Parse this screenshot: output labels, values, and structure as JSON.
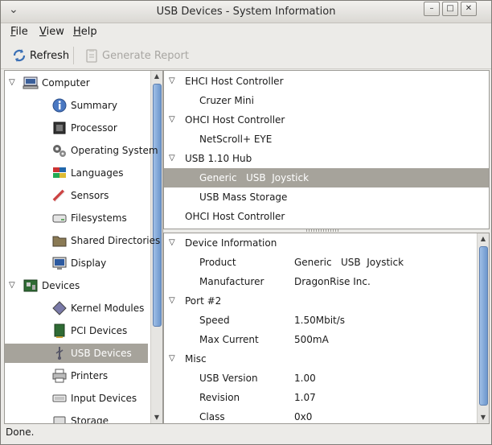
{
  "window": {
    "title": "USB Devices - System Information"
  },
  "menu": {
    "file": "File",
    "view": "View",
    "help": "Help"
  },
  "toolbar": {
    "refresh": "Refresh",
    "report": "Generate Report"
  },
  "sidebar": {
    "items": [
      {
        "label": "Computer",
        "icon": "computer-icon",
        "level": 0,
        "expanded": true
      },
      {
        "label": "Summary",
        "icon": "info-icon",
        "level": 1
      },
      {
        "label": "Processor",
        "icon": "processor-icon",
        "level": 1
      },
      {
        "label": "Operating System",
        "icon": "gears-icon",
        "level": 1
      },
      {
        "label": "Languages",
        "icon": "flags-icon",
        "level": 1
      },
      {
        "label": "Sensors",
        "icon": "sensors-icon",
        "level": 1
      },
      {
        "label": "Filesystems",
        "icon": "drive-icon",
        "level": 1
      },
      {
        "label": "Shared Directories",
        "icon": "folder-icon",
        "level": 1
      },
      {
        "label": "Display",
        "icon": "monitor-icon",
        "level": 1
      },
      {
        "label": "Devices",
        "icon": "board-icon",
        "level": 0,
        "expanded": true
      },
      {
        "label": "Kernel Modules",
        "icon": "module-icon",
        "level": 1
      },
      {
        "label": "PCI Devices",
        "icon": "pci-icon",
        "level": 1
      },
      {
        "label": "USB Devices",
        "icon": "usb-icon",
        "level": 1,
        "selected": true
      },
      {
        "label": "Printers",
        "icon": "printer-icon",
        "level": 1
      },
      {
        "label": "Input Devices",
        "icon": "keyboard-icon",
        "level": 1
      },
      {
        "label": "Storage",
        "icon": "storage-icon",
        "level": 1
      }
    ]
  },
  "devices": {
    "items": [
      {
        "label": "EHCI Host Controller",
        "level": 0,
        "expander": true
      },
      {
        "label": "Cruzer Mini",
        "level": 1
      },
      {
        "label": "OHCI Host Controller",
        "level": 0,
        "expander": true
      },
      {
        "label": "NetScroll+ EYE",
        "level": 1
      },
      {
        "label": "USB 1.10 Hub",
        "level": 0,
        "expander": true
      },
      {
        "label": "Generic   USB  Joystick",
        "level": 1,
        "selected": true
      },
      {
        "label": "USB Mass Storage",
        "level": 1
      },
      {
        "label": "OHCI Host Controller",
        "level": 0,
        "expander": false
      }
    ]
  },
  "details": {
    "rows": [
      {
        "label": "Device Information",
        "section": true
      },
      {
        "label": "Product",
        "value": "Generic   USB  Joystick"
      },
      {
        "label": "Manufacturer",
        "value": "DragonRise Inc."
      },
      {
        "label": "Port #2",
        "section": true
      },
      {
        "label": "Speed",
        "value": "1.50Mbit/s"
      },
      {
        "label": "Max Current",
        "value": "500mA"
      },
      {
        "label": "Misc",
        "section": true
      },
      {
        "label": "USB Version",
        "value": "1.00"
      },
      {
        "label": "Revision",
        "value": "1.07"
      },
      {
        "label": "Class",
        "value": "0x0"
      }
    ]
  },
  "status": {
    "text": "Done."
  }
}
